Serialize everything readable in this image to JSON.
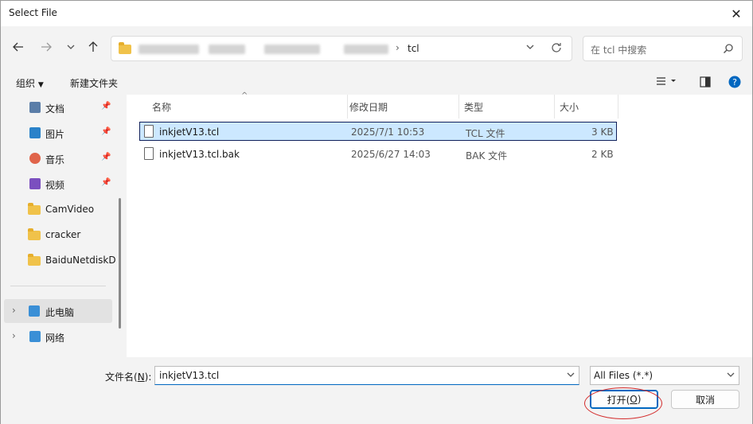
{
  "window": {
    "title": "Select File"
  },
  "nav": {
    "breadcrumb_last": "tcl",
    "search_placeholder": "在 tcl 中搜索"
  },
  "toolbar": {
    "organize": "组织",
    "new_folder": "新建文件夹"
  },
  "sidebar": {
    "items": [
      {
        "label": "文档",
        "pinned": true,
        "icon": "documents-icon"
      },
      {
        "label": "图片",
        "pinned": true,
        "icon": "pictures-icon"
      },
      {
        "label": "音乐",
        "pinned": true,
        "icon": "music-icon"
      },
      {
        "label": "视频",
        "pinned": true,
        "icon": "videos-icon"
      },
      {
        "label": "CamVideo",
        "icon": "folder-icon"
      },
      {
        "label": "cracker",
        "icon": "folder-icon"
      },
      {
        "label": "BaiduNetdiskD",
        "icon": "folder-icon"
      },
      {
        "label": "此电脑",
        "icon": "this-pc-icon"
      },
      {
        "label": "网络",
        "icon": "network-icon"
      }
    ]
  },
  "table": {
    "headers": {
      "name": "名称",
      "modified": "修改日期",
      "type": "类型",
      "size": "大小"
    },
    "rows": [
      {
        "name": "inkjetV13.tcl",
        "modified": "2025/7/1 10:53",
        "type": "TCL 文件",
        "size": "3 KB",
        "selected": true
      },
      {
        "name": "inkjetV13.tcl.bak",
        "modified": "2025/6/27 14:03",
        "type": "BAK 文件",
        "size": "2 KB"
      }
    ]
  },
  "bottom": {
    "filename_label": "文件名(",
    "filename_mnemonic": "N",
    "filename_label_end": "):",
    "filename_value": "inkjetV13.tcl",
    "filter_value": "All Files (*.*)",
    "open_label": "打开(",
    "open_mnemonic": "O",
    "open_label_end": ")",
    "cancel_label": "取消"
  },
  "colors": {
    "accent": "#0067c0",
    "selection": "#cce8ff",
    "annotation": "#d32b2b"
  }
}
